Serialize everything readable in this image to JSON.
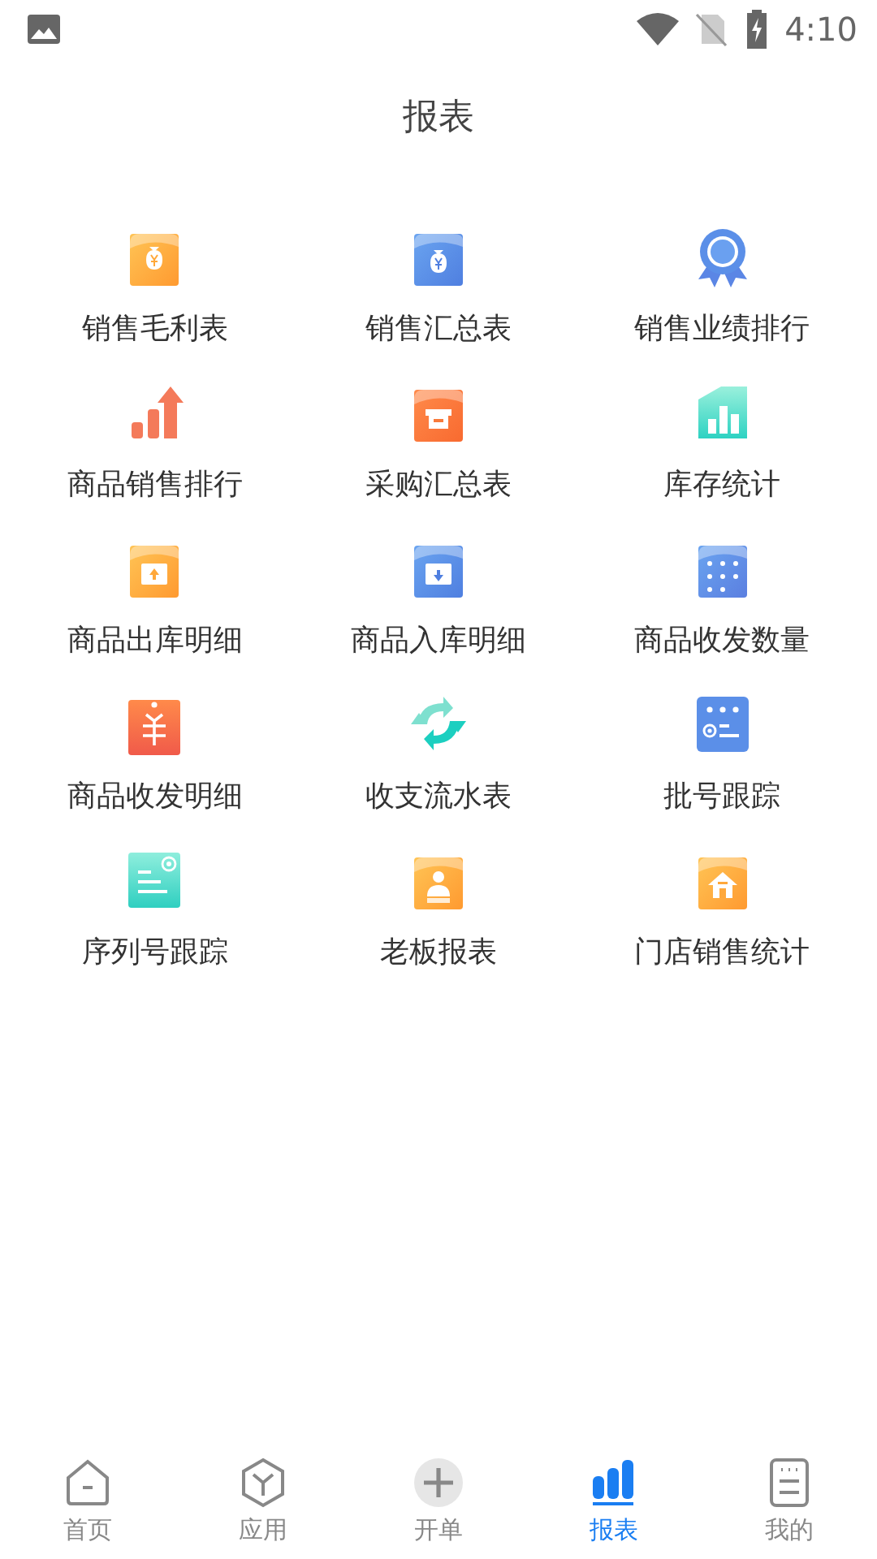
{
  "status_bar": {
    "time": "4:10"
  },
  "title": "报表",
  "reports": [
    {
      "label": "销售毛利表",
      "kind": "money-orange"
    },
    {
      "label": "销售汇总表",
      "kind": "money-blue"
    },
    {
      "label": "销售业绩排行",
      "kind": "medal"
    },
    {
      "label": "商品销售排行",
      "kind": "rising"
    },
    {
      "label": "采购汇总表",
      "kind": "basket"
    },
    {
      "label": "库存统计",
      "kind": "stock"
    },
    {
      "label": "商品出库明细",
      "kind": "box-out"
    },
    {
      "label": "商品入库明细",
      "kind": "box-in"
    },
    {
      "label": "商品收发数量",
      "kind": "dots"
    },
    {
      "label": "商品收发明细",
      "kind": "tag"
    },
    {
      "label": "收支流水表",
      "kind": "cycle"
    },
    {
      "label": "批号跟踪",
      "kind": "batch"
    },
    {
      "label": "序列号跟踪",
      "kind": "serial"
    },
    {
      "label": "老板报表",
      "kind": "boss"
    },
    {
      "label": "门店销售统计",
      "kind": "shop"
    }
  ],
  "nav": [
    {
      "label": "首页",
      "kind": "home",
      "selected": false
    },
    {
      "label": "应用",
      "kind": "apps",
      "selected": false
    },
    {
      "label": "开单",
      "kind": "add",
      "selected": false
    },
    {
      "label": "报表",
      "kind": "reports",
      "selected": true
    },
    {
      "label": "我的",
      "kind": "mine",
      "selected": false
    }
  ]
}
